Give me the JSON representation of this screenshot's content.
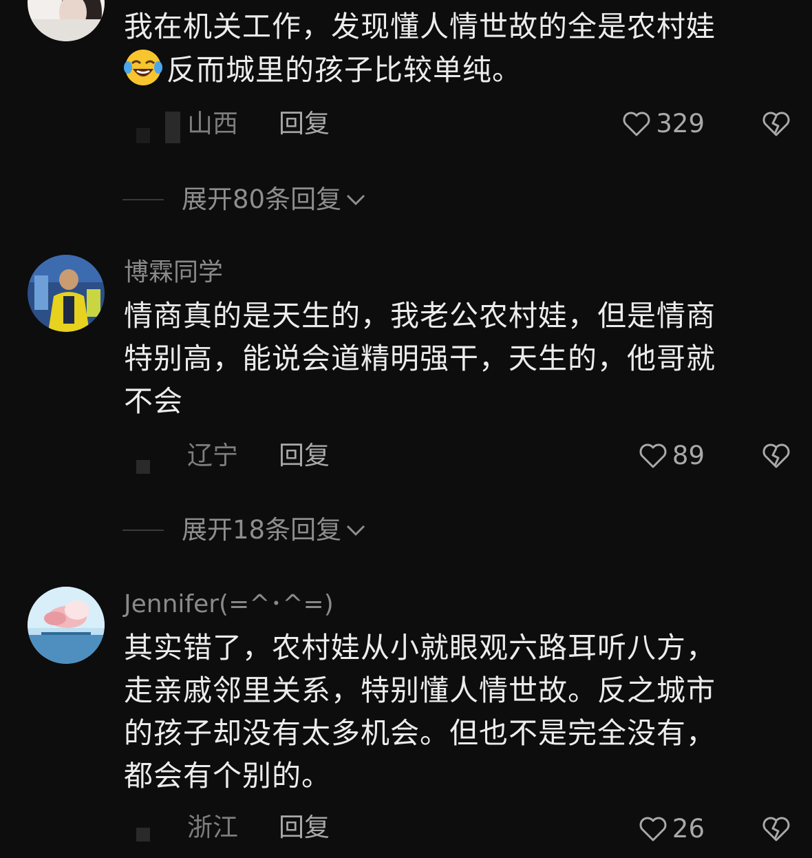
{
  "comments": [
    {
      "username": "",
      "lines": [
        "我在机关工作，发现懂人情世故的全是农村娃",
        "反而城里的孩子比较单纯。"
      ],
      "emoji": "laughing-with-tears-emoji",
      "location": "山西",
      "reply_label": "回复",
      "likes": "329",
      "expand_label": "展开80条回复"
    },
    {
      "username": "博霖同学",
      "lines": [
        "情商真的是天生的，我老公农村娃，但是情商",
        "特别高，能说会道精明强干，天生的，他哥就",
        "不会"
      ],
      "location": "辽宁",
      "reply_label": "回复",
      "likes": "89",
      "expand_label": "展开18条回复"
    },
    {
      "username": "Jennifer(=^･^=)",
      "lines": [
        "其实错了，农村娃从小就眼观六路耳听八方，",
        "走亲戚邻里关系，特别懂人情世故。反之城市",
        "的孩子却没有太多机会。但也不是完全没有，",
        "都会有个别的。"
      ],
      "location": "浙江",
      "reply_label": "回复",
      "likes": "26"
    }
  ],
  "icons": {
    "like": "heart-outline-icon",
    "dislike": "broken-heart-icon",
    "expand": "chevron-down-icon"
  },
  "colors": {
    "background": "#0d0d0d",
    "text_primary": "#ececec",
    "text_secondary": "#8a8a8a"
  }
}
